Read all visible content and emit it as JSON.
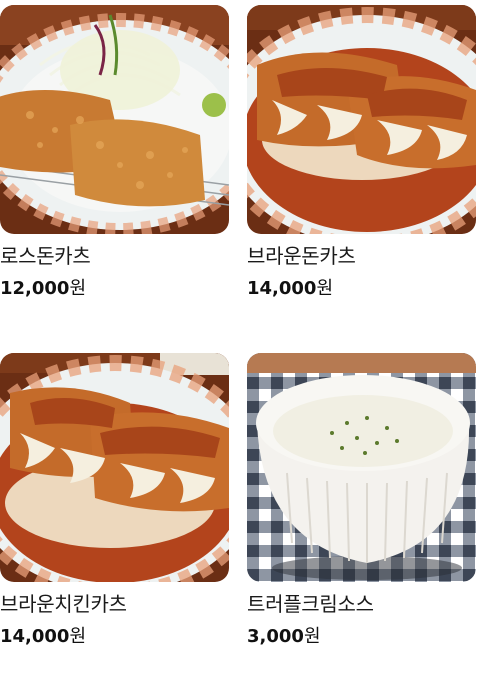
{
  "menu": {
    "items": [
      {
        "name": "로스돈카츠",
        "price": "12,000",
        "unit": "원"
      },
      {
        "name": "브라운돈카츠",
        "price": "14,000",
        "unit": "원"
      },
      {
        "name": "브라운치킨카츠",
        "price": "14,000",
        "unit": "원"
      },
      {
        "name": "트러플크림소스",
        "price": "3,000",
        "unit": "원"
      }
    ]
  },
  "colors": {
    "text": "#1a1a1a",
    "sauce": "#b3441c",
    "cutlet": "#d08a3c",
    "plate_rim": "#e9eef0",
    "plate_pattern": "#e8a07a",
    "table_wood": "#7a3a1c",
    "check_dark": "#3d4656",
    "bowl": "#f4f2ee"
  }
}
